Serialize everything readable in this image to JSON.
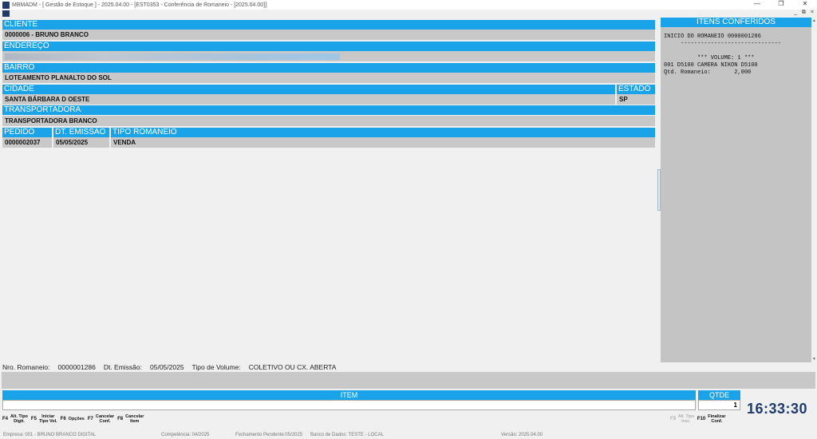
{
  "window": {
    "title": "MBMADM - [ Gestão de Estoque ] - 2025.04.00 - [EST0353 - Conferência de Romaneio - [2025.04.00]]",
    "minimize": "—",
    "maximize": "❐",
    "close": "✕"
  },
  "mdi": {
    "minimize": "_",
    "restore": "⧉",
    "close": "×"
  },
  "form": {
    "cliente": {
      "label": "CLIENTE",
      "value": "0000006 - BRUNO BRANCO"
    },
    "endereco": {
      "label": "ENDEREÇO",
      "value": ""
    },
    "bairro": {
      "label": "BAIRRO",
      "value": "LOTEAMENTO PLANALTO DO SOL"
    },
    "cidade": {
      "label": "CIDADE",
      "value": "SANTA BÁRBARA D OESTE"
    },
    "estado": {
      "label": "ESTADO",
      "value": "SP"
    },
    "transportadora": {
      "label": "TRANSPORTADORA",
      "value": "TRANSPORTADORA BRANCO"
    },
    "pedido": {
      "label": "PEDIDO",
      "value": "0000002037"
    },
    "dt_emissao": {
      "label": "DT. EMISSÃO",
      "value": "05/05/2025"
    },
    "tipo_romaneio": {
      "label": "TIPO ROMANEIO",
      "value": "VENDA"
    }
  },
  "itens_conferidos": {
    "title": "ITENS CONFERIDOS",
    "log": "INICIO DO ROMANEIO 0000001286\n     ------------------------------\n\n          *** VOLUME: 1 ***\n001 D5100 CAMERA NIKON D5100\nQtd. Romaneio:       2,000"
  },
  "info": {
    "nro_label": "Nro. Romaneio:",
    "nro_value": "0000001286",
    "dt_label": "Dt. Emissão:",
    "dt_value": "05/05/2025",
    "tipo_label": "Tipo de Volume:",
    "tipo_value": "COLETIVO OU CX. ABERTA"
  },
  "entry": {
    "item_label": "ITEM",
    "qtde_label": "QTDE",
    "qtde_value": "1",
    "clock": "16:33:30"
  },
  "fkeys": [
    {
      "key": "F4",
      "label": "Alt. Tipo\nDigit."
    },
    {
      "key": "F5",
      "label": "Iniciar\nTipo Vol."
    },
    {
      "key": "F6",
      "label": "Opções"
    },
    {
      "key": "F7",
      "label": "Cancelar\nConf."
    },
    {
      "key": "F8",
      "label": "Cancelar\nItem"
    }
  ],
  "fkeys_right": [
    {
      "key": "F9",
      "label": "Alt. Tipo\nInsc."
    },
    {
      "key": "F10",
      "label": "Finalizar\nConf."
    }
  ],
  "status": {
    "empresa": "Empresa: 001 - BRUNO BRANCO DIGITAL",
    "competencia": "Competência: 04/2025",
    "fechamento": "Fechamento Pendente:05/2025",
    "banco": "Banco de Dados: TESTE - LOCAL",
    "versao": "Versão: 2025.04.00"
  },
  "colors": {
    "header_blue": "#1aa3e8",
    "field_gray": "#c8c8c8",
    "clock_navy": "#1f3a6b"
  }
}
